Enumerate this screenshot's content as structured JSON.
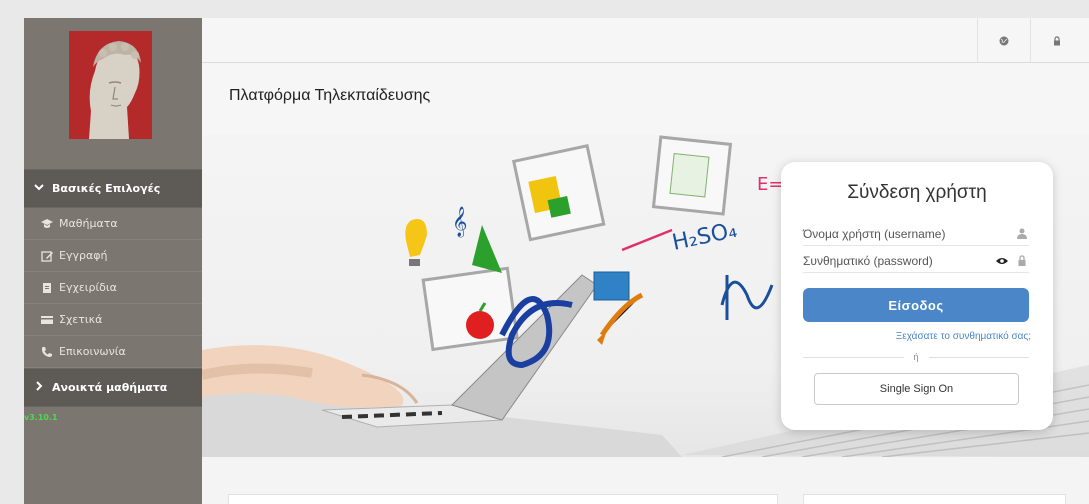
{
  "sidebar": {
    "section_main": "Βασικές Επιλογές",
    "items": [
      {
        "label": "Μαθήματα",
        "icon": "graduation-cap-icon"
      },
      {
        "label": "Εγγραφή",
        "icon": "edit-icon"
      },
      {
        "label": "Εγχειρίδια",
        "icon": "document-icon"
      },
      {
        "label": "Σχετικά",
        "icon": "card-icon"
      },
      {
        "label": "Επικοινωνία",
        "icon": "phone-icon"
      }
    ],
    "section_open": "Ανοικτά μαθήματα",
    "version": "v3.10.1"
  },
  "topbar": {
    "icons": [
      "globe-icon",
      "lock-icon"
    ]
  },
  "page": {
    "title": "Πλατφόρμα Τηλεκπαίδευσης"
  },
  "login": {
    "title": "Σύνδεση χρήστη",
    "username_placeholder": "Όνομα χρήστη (username)",
    "password_placeholder": "Συνθηματικό (password)",
    "login_button": "Είσοδος",
    "forgot_link": "Ξεχάσατε το συνθηματικό σας;",
    "or_text": "ή",
    "sso_button": "Single Sign On"
  },
  "colors": {
    "sidebar_bg": "#7b7670",
    "sidebar_header_bg": "#5e5a55",
    "accent_blue": "#4a86c8",
    "version_green": "#4dd84d",
    "logo_red": "#b42a2a"
  }
}
